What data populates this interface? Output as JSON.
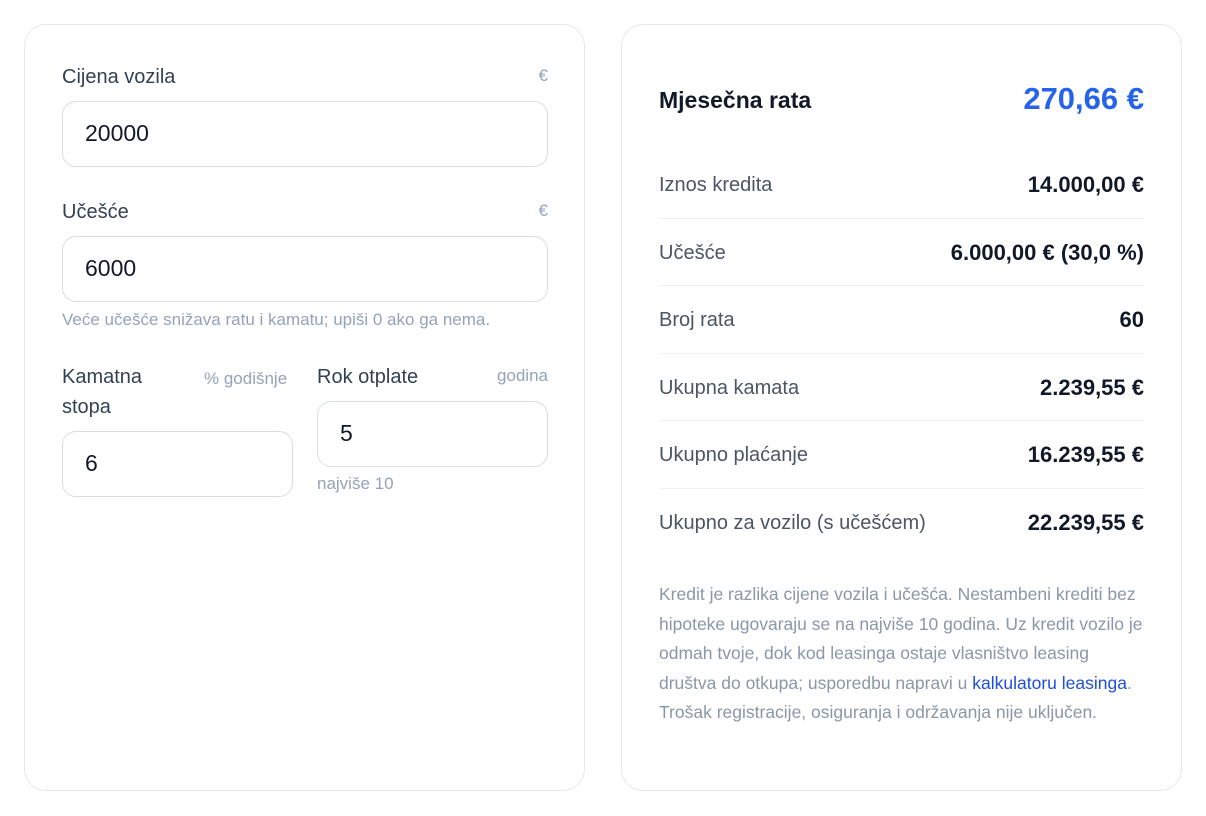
{
  "form": {
    "price": {
      "label": "Cijena vozila",
      "unit": "€",
      "value": "20000"
    },
    "down_payment": {
      "label": "Učešće",
      "unit": "€",
      "value": "6000",
      "hint": "Veće učešće snižava ratu i kamatu; upiši 0 ako ga nema."
    },
    "rate": {
      "label": "Kamatna stopa",
      "unit": "% godišnje",
      "value": "6"
    },
    "term": {
      "label": "Rok otplate",
      "unit": "godina",
      "value": "5",
      "hint": "najviše 10"
    }
  },
  "result": {
    "monthly_label": "Mjesečna rata",
    "monthly_value": "270,66 €",
    "rows": [
      {
        "label": "Iznos kredita",
        "value": "14.000,00 €"
      },
      {
        "label": "Učešće",
        "value": "6.000,00 € (30,0 %)"
      },
      {
        "label": "Broj rata",
        "value": "60"
      },
      {
        "label": "Ukupna kamata",
        "value": "2.239,55 €"
      },
      {
        "label": "Ukupno plaćanje",
        "value": "16.239,55 €"
      },
      {
        "label": "Ukupno za vozilo (s učešćem)",
        "value": "22.239,55 €"
      }
    ],
    "note": {
      "before_link": "Kredit je razlika cijene vozila i učešća. Nestambeni krediti bez hipoteke ugovaraju se na najviše 10 godina. Uz kredit vozilo je odmah tvoje, dok kod leasinga ostaje vlasništvo leasing društva do otkupa; usporedbu napravi u ",
      "link_text": "kalkulatoru leasinga",
      "after_link": ". Trošak registracije, osiguranja i održavanja nije uključen."
    }
  },
  "colors": {
    "accent": "#2563eb",
    "link": "#1d4ed8",
    "muted": "#94a3b8",
    "border": "#e5e7eb"
  }
}
